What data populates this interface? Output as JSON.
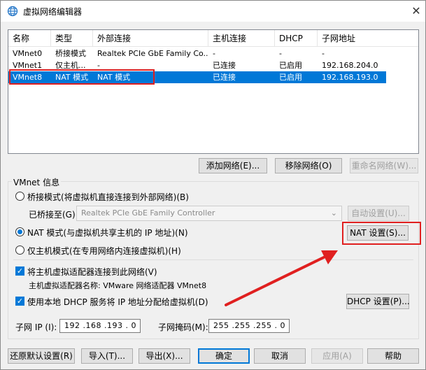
{
  "window": {
    "title": "虚拟网络编辑器",
    "close_glyph": "✕"
  },
  "table": {
    "columns": [
      "名称",
      "类型",
      "外部连接",
      "主机连接",
      "DHCP",
      "子网地址"
    ],
    "rows": [
      [
        "VMnet0",
        "桥接模式",
        "Realtek PCIe GbE Family Co...",
        "-",
        "-",
        "-"
      ],
      [
        "VMnet1",
        "仅主机...",
        "-",
        "已连接",
        "已启用",
        "192.168.204.0"
      ],
      [
        "VMnet8",
        "NAT 模式",
        "NAT 模式",
        "已连接",
        "已启用",
        "192.168.193.0"
      ]
    ],
    "selected_row": 2
  },
  "list_buttons": {
    "add": "添加网络(E)...",
    "remove": "移除网络(O)",
    "rename": "重命名网络(W)..."
  },
  "vmnet_info": {
    "group_title": "VMnet 信息",
    "bridge_radio": "桥接模式(将虚拟机直接连接到外部网络)(B)",
    "bridged_to_label": "已桥接至(G):",
    "bridged_to_value": "Realtek PCIe GbE Family Controller",
    "auto_settings": "自动设置(U)...",
    "nat_radio": "NAT 模式(与虚拟机共享主机的 IP 地址)(N)",
    "nat_settings": "NAT 设置(S)...",
    "hostonly_radio": "仅主机模式(在专用网络内连接虚拟机)(H)",
    "connect_adapter_check": "将主机虚拟适配器连接到此网络(V)",
    "adapter_name_line": "主机虚拟适配器名称: VMware 网络适配器 VMnet8",
    "dhcp_check": "使用本地 DHCP 服务将 IP 地址分配给虚拟机(D)",
    "dhcp_settings": "DHCP 设置(P)...",
    "subnet_ip_label": "子网 IP (I):",
    "subnet_ip_value": "192 .168 .193 .  0",
    "subnet_mask_label": "子网掩码(M):",
    "subnet_mask_value": "255 .255 .255 .  0"
  },
  "footer_buttons": {
    "restore": "还原默认设置(R)",
    "import": "导入(T)...",
    "export": "导出(X)...",
    "ok": "确定",
    "cancel": "取消",
    "apply": "应用(A)",
    "help": "帮助"
  },
  "annotation": {
    "color": "#e02020"
  }
}
